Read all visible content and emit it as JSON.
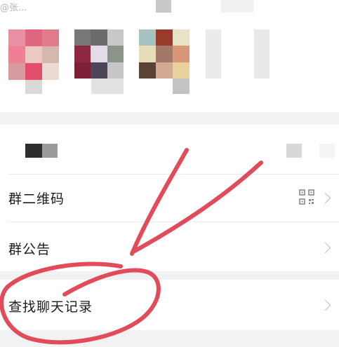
{
  "header": {
    "member_name": "@张..."
  },
  "group_settings": {
    "rows": [
      {
        "label": "群二维码",
        "icon": "qr-code-icon",
        "chevron": "chevron-right-icon"
      },
      {
        "label": "群公告",
        "chevron": "chevron-right-icon"
      },
      {
        "label": "查找聊天记录",
        "chevron": "chevron-right-icon"
      }
    ]
  },
  "annotation": {
    "color": "#e24b5a"
  }
}
